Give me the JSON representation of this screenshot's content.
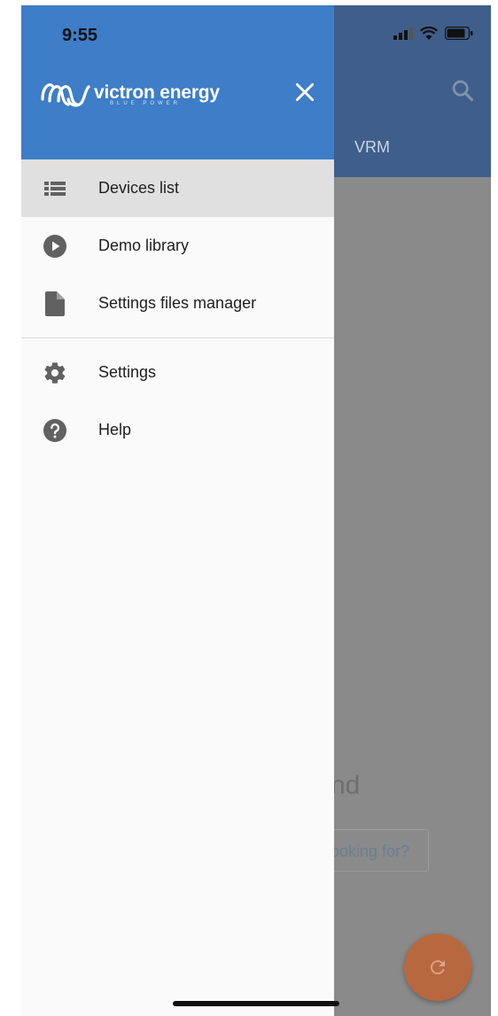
{
  "status_bar": {
    "time": "9:55"
  },
  "background": {
    "tab_label": "VRM",
    "partial_title": "nd",
    "partial_link": "ooking for?"
  },
  "drawer": {
    "brand_name": "victron energy",
    "brand_tagline": "BLUE POWER",
    "menu_primary": [
      {
        "label": "Devices list",
        "icon": "list-icon",
        "active": true
      },
      {
        "label": "Demo library",
        "icon": "play-circle-icon",
        "active": false
      },
      {
        "label": "Settings files manager",
        "icon": "file-icon",
        "active": false
      }
    ],
    "menu_secondary": [
      {
        "label": "Settings",
        "icon": "gear-icon"
      },
      {
        "label": "Help",
        "icon": "help-circle-icon"
      }
    ]
  },
  "colors": {
    "drawer_header": "#3e7dc7",
    "app_header": "#3f5f8a",
    "scrim": "#8a8a8a",
    "fab": "#b8683e",
    "active_item": "#e0e0e0",
    "icon": "#616161"
  }
}
